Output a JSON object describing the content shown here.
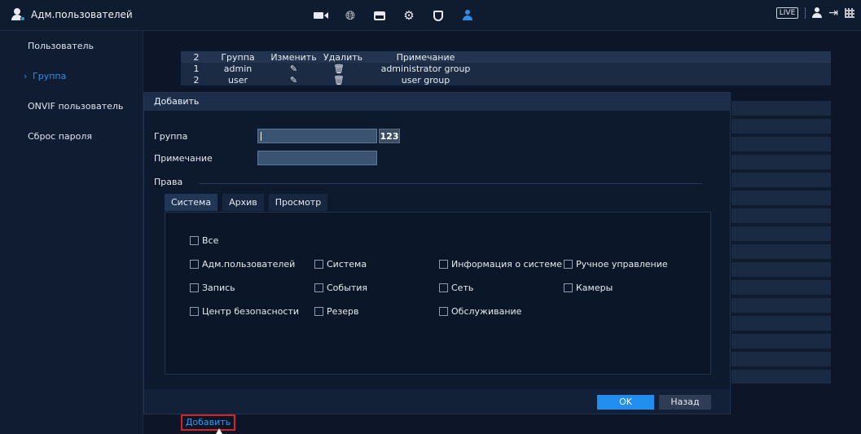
{
  "app": {
    "title": "Адм.пользователей",
    "live_label": "LIVE",
    "top_icons": [
      "camera-icon",
      "globe-icon",
      "hdd-icon",
      "gear-icon",
      "shield-icon",
      "users-gear-icon"
    ]
  },
  "sidebar": {
    "items": [
      {
        "label": "Пользователь"
      },
      {
        "label": "Группа",
        "active": true
      },
      {
        "label": "ONVIF пользователь"
      },
      {
        "label": "Сброс пароля"
      }
    ],
    "arrow": "›"
  },
  "group_table": {
    "headers": {
      "count": "2",
      "group": "Группа",
      "edit": "Изменить",
      "delete": "Удалить",
      "note": "Примечание"
    },
    "rows": [
      {
        "num": "1",
        "group": "admin",
        "edit": "✎",
        "delete": "🗑",
        "note": "administrator group"
      },
      {
        "num": "2",
        "group": "user",
        "edit": "✎",
        "delete": "🗑",
        "note": "user group"
      }
    ]
  },
  "dialog": {
    "title": "Добавить",
    "group_label": "Группа",
    "note_label": "Примечание",
    "rights_label": "Права",
    "kbd_label": "123",
    "tabs": [
      "Система",
      "Архив",
      "Просмотр"
    ],
    "checkboxes": {
      "all": "Все",
      "user_admin": "Адм.пользователей",
      "system": "Система",
      "system_info": "Информация о системе",
      "manual_control": "Ручное управление",
      "record": "Запись",
      "events": "События",
      "network": "Сеть",
      "cameras": "Камеры",
      "security_center": "Центр безопасности",
      "backup": "Резерв",
      "maintenance": "Обслуживание"
    },
    "ok_label": "OK",
    "back_label": "Назад"
  },
  "footer": {
    "add_label": "Добавить"
  }
}
